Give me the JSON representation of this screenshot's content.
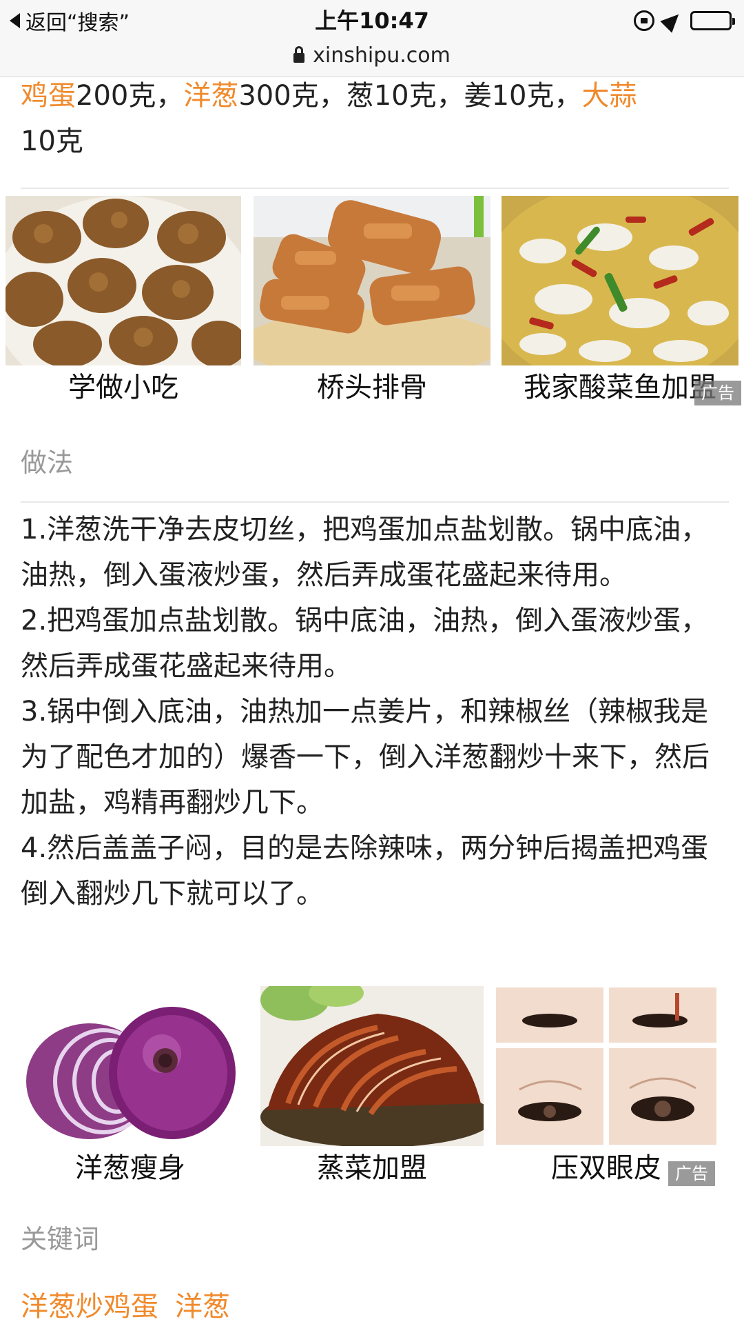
{
  "status_bar": {
    "back_label": "返回“搜索”",
    "time": "上午10:47",
    "icons": [
      "rotation-lock-icon",
      "location-icon",
      "battery-icon"
    ]
  },
  "url_bar": {
    "domain": "xinshipu.com"
  },
  "ingredients": {
    "parts": [
      {
        "text": "鸡蛋",
        "highlight": true
      },
      {
        "text": "200克，",
        "highlight": false
      },
      {
        "text": "洋葱",
        "highlight": true
      },
      {
        "text": "300克，葱10克，姜10克，",
        "highlight": false
      },
      {
        "text": "大蒜",
        "highlight": true
      },
      {
        "text": "10克",
        "highlight": false
      }
    ]
  },
  "rec_row_1": {
    "items": [
      {
        "caption": "学做小吃",
        "image": "meatball-fritters-photo"
      },
      {
        "caption": "桥头排骨",
        "image": "fried-ribs-photo"
      },
      {
        "caption": "我家酸菜鱼加盟",
        "image": "pickled-fish-soup-photo"
      }
    ],
    "ad_label": "广告"
  },
  "method": {
    "heading": "做法",
    "steps": [
      "1.洋葱洗干净去皮切丝，把鸡蛋加点盐划散。锅中底油，油热，倒入蛋液炒蛋，然后弄成蛋花盛起来待用。",
      "2.把鸡蛋加点盐划散。锅中底油，油热，倒入蛋液炒蛋，然后弄成蛋花盛起来待用。",
      "3.锅中倒入底油，油热加一点姜片，和辣椒丝（辣椒我是为了配色才加的）爆香一下，倒入洋葱翻炒十来下，然后加盐，鸡精再翻炒几下。",
      "4.然后盖盖子闷，目的是去除辣味，两分钟后揭盖把鸡蛋倒入翻炒几下就可以了。"
    ]
  },
  "rec_row_2": {
    "items": [
      {
        "caption": "洋葱瘦身",
        "image": "red-onion-photo"
      },
      {
        "caption": "蒸菜加盟",
        "image": "braised-pork-photo"
      },
      {
        "caption": "压双眼皮",
        "image": "eyelid-photo"
      }
    ],
    "ad_label": "广告"
  },
  "keywords": {
    "heading": "关键词",
    "items": [
      "洋葱炒鸡蛋",
      "洋葱"
    ]
  },
  "colors": {
    "accent": "#f08a2c",
    "section_heading": "#999999",
    "ad_badge": "#7a7a7a"
  }
}
